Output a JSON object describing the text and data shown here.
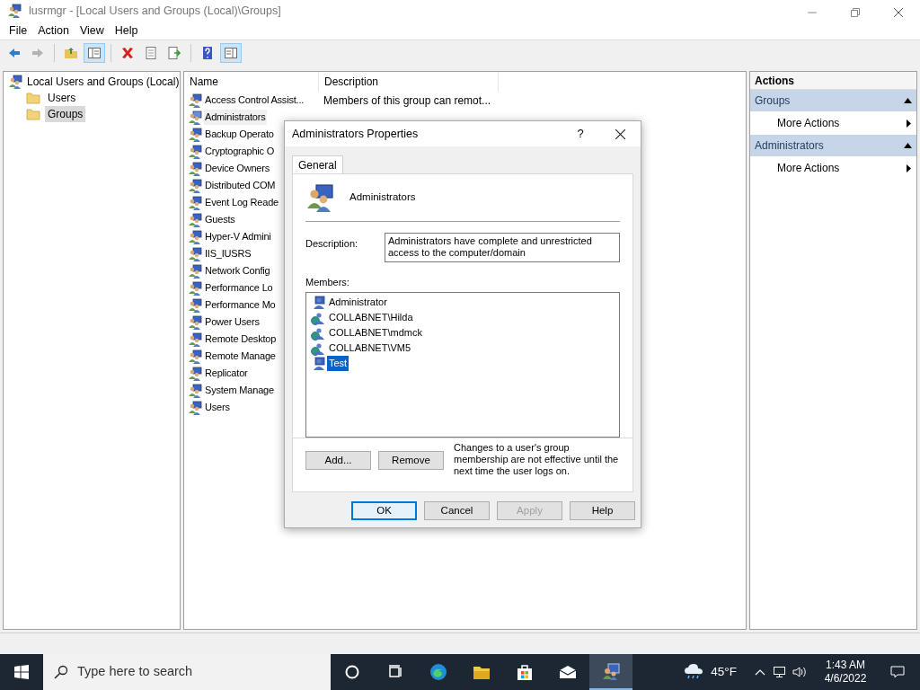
{
  "window": {
    "title": "lusrmgr - [Local Users and Groups (Local)\\Groups]"
  },
  "menu": [
    "File",
    "Action",
    "View",
    "Help"
  ],
  "toolbar": [
    {
      "kind": "back",
      "disabled": false,
      "pressed": false
    },
    {
      "kind": "forward",
      "disabled": true,
      "pressed": false
    },
    {
      "kind": "sep"
    },
    {
      "kind": "up",
      "disabled": false,
      "pressed": false
    },
    {
      "kind": "tree",
      "disabled": false,
      "pressed": true
    },
    {
      "kind": "sep"
    },
    {
      "kind": "delete",
      "disabled": false,
      "pressed": false
    },
    {
      "kind": "properties",
      "disabled": false,
      "pressed": false
    },
    {
      "kind": "export",
      "disabled": false,
      "pressed": false
    },
    {
      "kind": "sep"
    },
    {
      "kind": "help",
      "disabled": false,
      "pressed": false
    },
    {
      "kind": "actionpane",
      "disabled": false,
      "pressed": true
    }
  ],
  "tree": {
    "label": "Local Users and Groups (Local)",
    "children": [
      {
        "label": "Users",
        "selected": false
      },
      {
        "label": "Groups",
        "selected": true
      }
    ]
  },
  "list": {
    "columns": [
      "Name",
      "Description"
    ],
    "rows": [
      {
        "name": "Access Control Assist...",
        "description": "Members of this group can remot...",
        "selected": false
      },
      {
        "name": "Administrators",
        "selected": true
      },
      {
        "name": "Backup Operato",
        "selected": false
      },
      {
        "name": "Cryptographic O",
        "selected": false
      },
      {
        "name": "Device Owners",
        "selected": false
      },
      {
        "name": "Distributed COM",
        "selected": false
      },
      {
        "name": "Event Log Reade",
        "selected": false
      },
      {
        "name": "Guests",
        "selected": false
      },
      {
        "name": "Hyper-V Admini",
        "selected": false
      },
      {
        "name": "IIS_IUSRS",
        "selected": false
      },
      {
        "name": "Network Config",
        "selected": false
      },
      {
        "name": "Performance Lo",
        "selected": false
      },
      {
        "name": "Performance Mo",
        "selected": false
      },
      {
        "name": "Power Users",
        "selected": false
      },
      {
        "name": "Remote Desktop",
        "selected": false
      },
      {
        "name": "Remote Manage",
        "selected": false
      },
      {
        "name": "Replicator",
        "selected": false
      },
      {
        "name": "System Manage",
        "selected": false
      },
      {
        "name": "Users",
        "selected": false
      }
    ]
  },
  "actions": {
    "title": "Actions",
    "sections": [
      {
        "title": "Groups",
        "expanded": true,
        "items": [
          "More Actions"
        ]
      },
      {
        "title": "Administrators",
        "expanded": true,
        "items": [
          "More Actions"
        ]
      }
    ]
  },
  "dialog": {
    "title": "Administrators Properties",
    "help": "?",
    "tabs": [
      {
        "label": "General",
        "selected": true
      }
    ],
    "group_name": "Administrators",
    "description_label": "Description:",
    "description": "Administrators have complete and unrestricted access to the computer/domain",
    "members_label": "Members:",
    "members": [
      {
        "kind": "local",
        "name": "Administrator",
        "selected": false
      },
      {
        "kind": "domain",
        "name": "COLLABNET\\Hilda",
        "selected": false
      },
      {
        "kind": "domain",
        "name": "COLLABNET\\mdmck",
        "selected": false
      },
      {
        "kind": "domain",
        "name": "COLLABNET\\VM5",
        "selected": false
      },
      {
        "kind": "local",
        "name": "Test",
        "selected": true
      }
    ],
    "member_buttons": [
      "Add...",
      "Remove"
    ],
    "note": "Changes to a user's group membership are not effective until the next time the user logs on.",
    "buttons": [
      {
        "label": "OK",
        "default": true,
        "disabled": false
      },
      {
        "label": "Cancel",
        "default": false,
        "disabled": false
      },
      {
        "label": "Apply",
        "default": false,
        "disabled": true
      },
      {
        "label": "Help",
        "default": false,
        "disabled": false
      }
    ]
  },
  "taskbar": {
    "search_placeholder": "Type here to search",
    "apps": [
      {
        "kind": "cortana",
        "active": false
      },
      {
        "kind": "taskview",
        "active": false
      },
      {
        "kind": "edge",
        "active": false
      },
      {
        "kind": "explorer",
        "active": false
      },
      {
        "kind": "store",
        "active": false
      },
      {
        "kind": "mail",
        "active": false
      },
      {
        "kind": "lusrmgr",
        "active": true
      }
    ],
    "temperature": "45°F",
    "time": "1:43 AM",
    "date": "4/6/2022"
  }
}
